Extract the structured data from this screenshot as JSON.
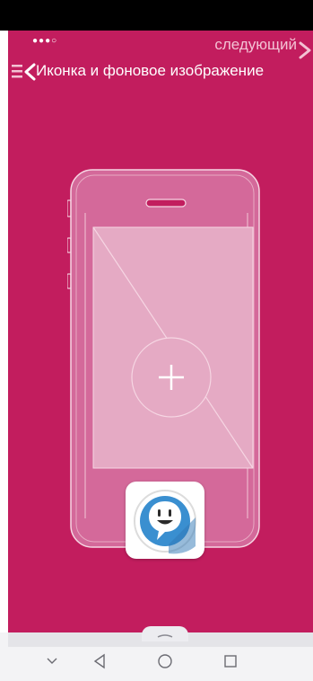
{
  "header": {
    "page_dots": "●●●○",
    "next_label": "следующий",
    "title": "Иконка и фоновое изображение"
  },
  "icons": {
    "menu": "menu-icon",
    "back": "chevron-left-icon",
    "next": "chevron-right-icon",
    "add": "plus-icon",
    "app": "chat-smiley-icon",
    "nav_down": "chevron-down-icon",
    "nav_back": "triangle-back-icon",
    "nav_home": "circle-home-icon",
    "nav_recents": "square-recents-icon"
  },
  "colors": {
    "background": "#c21d5e",
    "accent": "#3a8fd0"
  }
}
